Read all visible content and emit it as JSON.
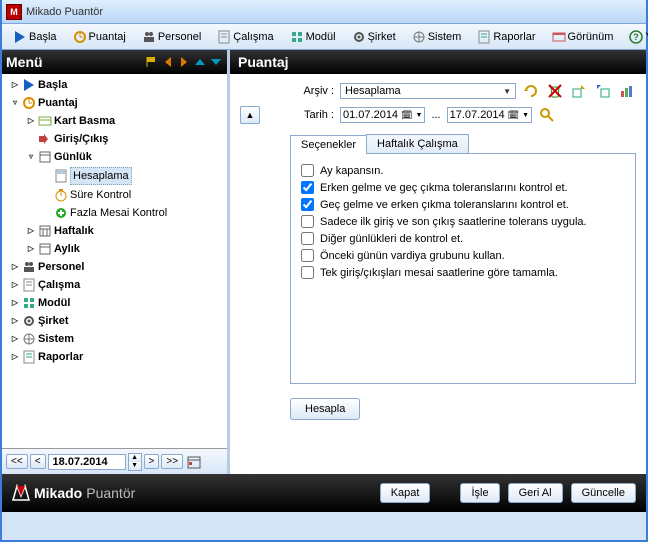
{
  "app": {
    "title": "Mikado Puantör"
  },
  "toolbar": [
    {
      "id": "basla",
      "label": "Başla"
    },
    {
      "id": "puantaj",
      "label": "Puantaj"
    },
    {
      "id": "personel",
      "label": "Personel"
    },
    {
      "id": "calisma",
      "label": "Çalışma"
    },
    {
      "id": "modul",
      "label": "Modül"
    },
    {
      "id": "sirket",
      "label": "Şirket"
    },
    {
      "id": "sistem",
      "label": "Sistem"
    },
    {
      "id": "raporlar",
      "label": "Raporlar"
    },
    {
      "id": "gorunum",
      "label": "Görünüm"
    },
    {
      "id": "yardim",
      "label": "Yardım"
    }
  ],
  "left": {
    "title": "Menü",
    "bottom_date": "18.07.2014"
  },
  "tree": {
    "basla": "Başla",
    "puantaj": "Puantaj",
    "kart_basma": "Kart Basma",
    "giris_cikis": "Giriş/Çıkış",
    "gunluk": "Günlük",
    "hesaplama": "Hesaplama",
    "sure_kontrol": "Süre Kontrol",
    "fazla_mesai": "Fazla Mesai Kontrol",
    "haftalik": "Haftalık",
    "aylik": "Aylık",
    "personel": "Personel",
    "calisma": "Çalışma",
    "modul": "Modül",
    "sirket": "Şirket",
    "sistem": "Sistem",
    "raporlar": "Raporlar"
  },
  "right": {
    "title": "Puantaj",
    "arsiv_label": "Arşiv :",
    "arsiv_value": "Hesaplama",
    "tarih_label": "Tarih :",
    "date_from": "01.07.2014",
    "date_sep": "...",
    "date_to": "17.07.2014",
    "tabs": {
      "secenekler": "Seçenekler",
      "haftalik": "Haftalık Çalışma"
    },
    "checks": [
      {
        "text": "Ay kapansın.",
        "checked": false
      },
      {
        "text": "Erken gelme ve geç çıkma toleranslarını kontrol et.",
        "checked": true
      },
      {
        "text": "Geç gelme ve erken çıkma toleranslarını kontrol et.",
        "checked": true
      },
      {
        "text": "Sadece ilk giriş ve son çıkış saatlerine tolerans uygula.",
        "checked": false
      },
      {
        "text": "Diğer günlükleri de kontrol et.",
        "checked": false
      },
      {
        "text": "Önceki günün vardiya grubunu kullan.",
        "checked": false
      },
      {
        "text": "Tek giriş/çıkışları mesai saatlerine göre tamamla.",
        "checked": false
      }
    ],
    "hesapla": "Hesapla"
  },
  "bottom": {
    "brand1": "Mikado",
    "brand2": "Puantör",
    "kapat": "Kapat",
    "isle": "İşle",
    "gerial": "Geri Al",
    "guncelle": "Güncelle"
  },
  "nav": {
    "first": "<<",
    "prev": "<",
    "next": ">",
    "last": ">>"
  }
}
